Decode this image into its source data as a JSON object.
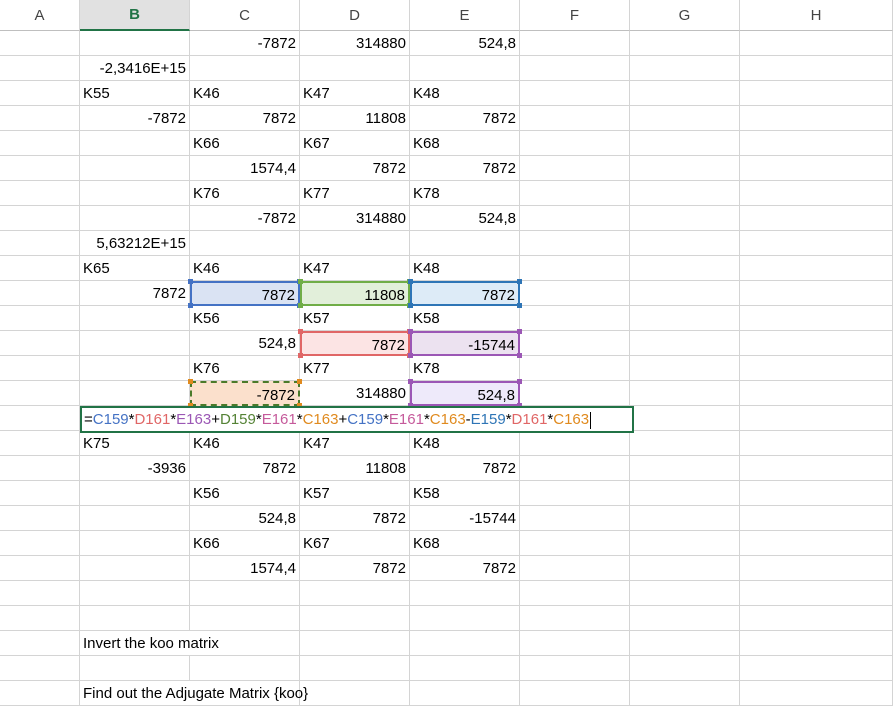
{
  "columns": [
    {
      "label": "A",
      "selected": false
    },
    {
      "label": "B",
      "selected": true
    },
    {
      "label": "C",
      "selected": false
    },
    {
      "label": "D",
      "selected": false
    },
    {
      "label": "E",
      "selected": false
    },
    {
      "label": "F",
      "selected": false
    },
    {
      "label": "G",
      "selected": false
    },
    {
      "label": "H",
      "selected": false
    }
  ],
  "rows": [
    [
      "",
      "",
      "-7872",
      "314880",
      "524,8",
      "",
      "",
      ""
    ],
    [
      "",
      "-2,3416E+15",
      "",
      "",
      "",
      "",
      "",
      ""
    ],
    [
      "",
      "K55",
      "K46",
      "K47",
      "K48",
      "",
      "",
      ""
    ],
    [
      "",
      "-7872",
      "7872",
      "11808",
      "7872",
      "",
      "",
      ""
    ],
    [
      "",
      "",
      "K66",
      "K67",
      "K68",
      "",
      "",
      ""
    ],
    [
      "",
      "",
      "1574,4",
      "7872",
      "7872",
      "",
      "",
      ""
    ],
    [
      "",
      "",
      "K76",
      "K77",
      "K78",
      "",
      "",
      ""
    ],
    [
      "",
      "",
      "-7872",
      "314880",
      "524,8",
      "",
      "",
      ""
    ],
    [
      "",
      "5,63212E+15",
      "",
      "",
      "",
      "",
      "",
      ""
    ],
    [
      "",
      "K65",
      "K46",
      "K47",
      "K48",
      "",
      "",
      ""
    ],
    [
      "",
      "7872",
      "7872",
      "11808",
      "7872",
      "",
      "",
      ""
    ],
    [
      "",
      "",
      "K56",
      "K57",
      "K58",
      "",
      "",
      ""
    ],
    [
      "",
      "",
      "524,8",
      "7872",
      "-15744",
      "",
      "",
      ""
    ],
    [
      "",
      "",
      "K76",
      "K77",
      "K78",
      "",
      "",
      ""
    ],
    [
      "",
      "",
      "-7872",
      "314880",
      "524,8",
      "",
      "",
      ""
    ],
    [
      "",
      "",
      "",
      "",
      "",
      "",
      "",
      ""
    ],
    [
      "",
      "K75",
      "K46",
      "K47",
      "K48",
      "",
      "",
      ""
    ],
    [
      "",
      "-3936",
      "7872",
      "11808",
      "7872",
      "",
      "",
      ""
    ],
    [
      "",
      "",
      "K56",
      "K57",
      "K58",
      "",
      "",
      ""
    ],
    [
      "",
      "",
      "524,8",
      "7872",
      "-15744",
      "",
      "",
      ""
    ],
    [
      "",
      "",
      "K66",
      "K67",
      "K68",
      "",
      "",
      ""
    ],
    [
      "",
      "",
      "1574,4",
      "7872",
      "7872",
      "",
      "",
      ""
    ],
    [
      "",
      "",
      "",
      "",
      "",
      "",
      "",
      ""
    ],
    [
      "",
      "",
      "",
      "",
      "",
      "",
      "",
      ""
    ],
    [
      "",
      "Invert the koo matrix",
      "",
      "",
      "",
      "",
      "",
      ""
    ],
    [
      "",
      "",
      "",
      "",
      "",
      "",
      "",
      ""
    ],
    [
      "",
      "Find out the Adjugate Matrix {koo}",
      "",
      "",
      "",
      "",
      "",
      ""
    ]
  ],
  "formula_tokens": [
    {
      "text": "=",
      "color": "#000000"
    },
    {
      "text": "C159",
      "color": "#4472c4"
    },
    {
      "text": "*",
      "color": "#000000"
    },
    {
      "text": "D161",
      "color": "#e06666"
    },
    {
      "text": "*",
      "color": "#000000"
    },
    {
      "text": "E163",
      "color": "#9b57b5"
    },
    {
      "text": "+",
      "color": "#000000"
    },
    {
      "text": "D159",
      "color": "#548235"
    },
    {
      "text": "*",
      "color": "#000000"
    },
    {
      "text": "E161",
      "color": "#c55a9b"
    },
    {
      "text": "*",
      "color": "#000000"
    },
    {
      "text": "C163",
      "color": "#e08a1e"
    },
    {
      "text": "+",
      "color": "#000000"
    },
    {
      "text": "C159",
      "color": "#4472c4"
    },
    {
      "text": "*",
      "color": "#000000"
    },
    {
      "text": "E161",
      "color": "#c55a9b"
    },
    {
      "text": "*",
      "color": "#000000"
    },
    {
      "text": "C163",
      "color": "#e08a1e"
    },
    {
      "text": "-",
      "color": "#000000"
    },
    {
      "text": "E159",
      "color": "#2e75b6"
    },
    {
      "text": "*",
      "color": "#000000"
    },
    {
      "text": "D161",
      "color": "#e06666"
    },
    {
      "text": "*",
      "color": "#000000"
    },
    {
      "text": "C163",
      "color": "#e08a1e"
    }
  ],
  "colors": {
    "selected_header": "#217346",
    "gridline": "#d4d4d4"
  }
}
